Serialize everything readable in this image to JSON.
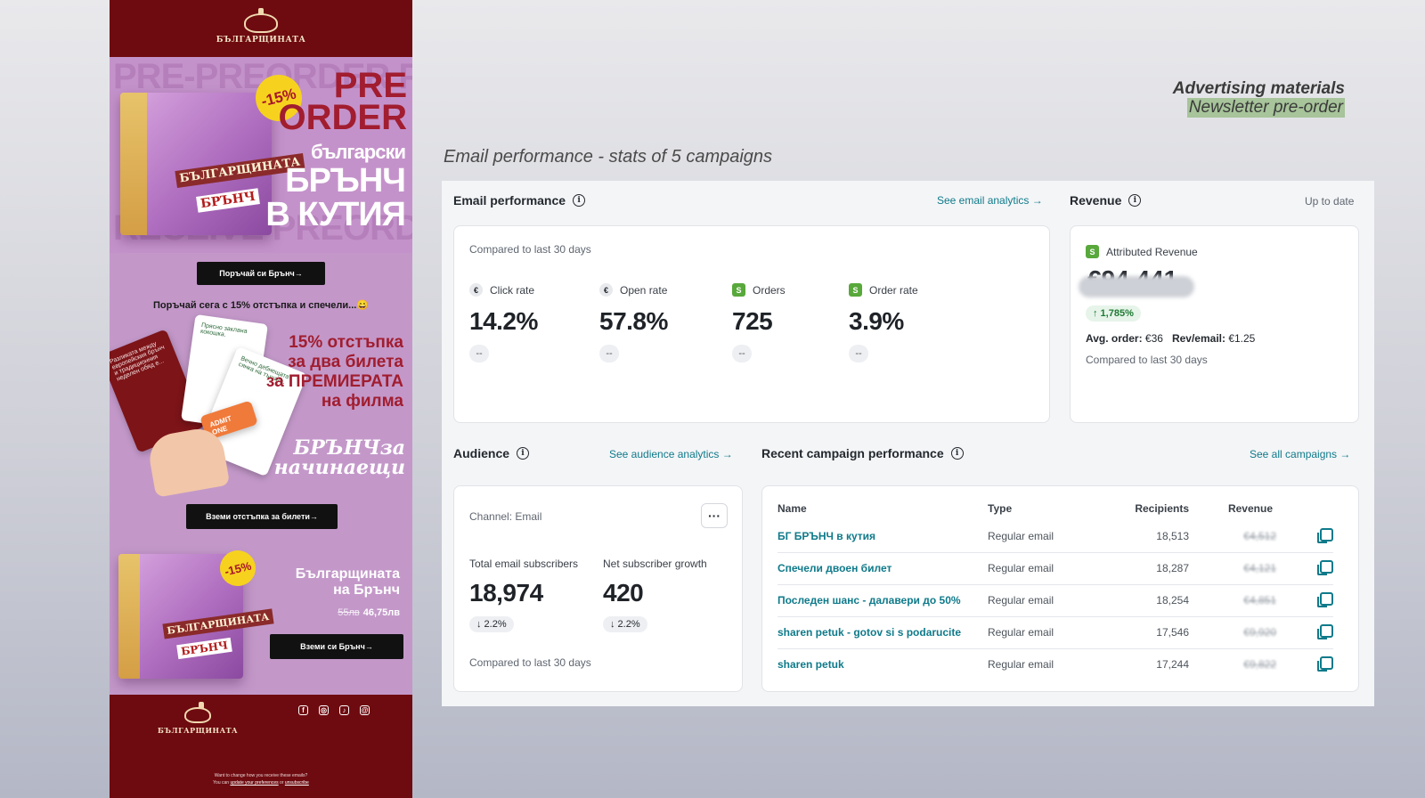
{
  "header": {
    "title": "Advertising materials",
    "subtitle": "Newsletter pre-order",
    "section": "Email performance - stats of 5 campaigns"
  },
  "newsletter": {
    "brand": "БЪЛГАРЩИНАТА",
    "badge": "-15%",
    "preorder_line1": "PRE",
    "preorder_line2": "ORDER",
    "hero_line1": "български",
    "hero_line2": "БРЪНЧ",
    "hero_line3": "В КУТИЯ",
    "box_label": "БЪЛГАРЩИНАТА",
    "box_sub": "БРЪНЧ",
    "cta1": "Поръчай си Брънч→",
    "promo_line": "Поръчай сега с 15% отстъпка и спечели...😄",
    "card1": "Разликата между европейския брънч и традиционния неделен обяд е...",
    "card2": "Прясно заклана кокошка.",
    "card3": "Вечно дебнещата сянка на тъщата.",
    "ticket": "ADMIT ONE",
    "offer_line1": "15% отстъпка",
    "offer_line2": "за два билета",
    "offer_line3": "за ПРЕМИЕРАТА",
    "offer_line4": "на филма",
    "script_line1": "БРЪНЧза",
    "script_line2": "начинаещи",
    "cta2": "Вземи отстъпка за билети→",
    "badge2": "-15%",
    "product_title1": "Българщината",
    "product_title2": "на Брънч",
    "price_old": "55лв",
    "price_new": "46,75лв",
    "cta3": "Вземи си Брънч→",
    "footer_brand": "БЪЛГАРЩИНАТА",
    "footer_note": "Want to change how you receive these emails?",
    "footer_you_can": "You can",
    "footer_update": "update your preferences",
    "footer_or": "or",
    "footer_unsub": "unsubscribe",
    "social_icons": [
      "facebook-icon",
      "instagram-icon",
      "tiktok-icon",
      "threads-icon"
    ]
  },
  "email_perf": {
    "title": "Email performance",
    "link": "See email analytics →",
    "compared": "Compared to last 30 days",
    "metrics": [
      {
        "label": "Click rate",
        "value": "14.2%",
        "delta": "--",
        "icon": "klaviyo-icon"
      },
      {
        "label": "Open rate",
        "value": "57.8%",
        "delta": "--",
        "icon": "klaviyo-icon"
      },
      {
        "label": "Orders",
        "value": "725",
        "delta": "--",
        "icon": "shopify-icon"
      },
      {
        "label": "Order rate",
        "value": "3.9%",
        "delta": "--",
        "icon": "shopify-icon"
      }
    ]
  },
  "revenue": {
    "title": "Revenue",
    "status": "Up to date",
    "label": "Attributed Revenue",
    "value_partial": "€94,441",
    "change": "↑ 1,785%",
    "avg_label": "Avg. order:",
    "avg_value": "€36",
    "rev_label": "Rev/email:",
    "rev_value": "€1.25",
    "compared": "Compared to last 30 days"
  },
  "audience": {
    "title": "Audience",
    "link": "See audience analytics →",
    "channel": "Channel: Email",
    "more": "···",
    "subs_label": "Total email subscribers",
    "subs_value": "18,974",
    "subs_delta": "↓ 2.2%",
    "growth_label": "Net subscriber growth",
    "growth_value": "420",
    "growth_delta": "↓ 2.2%",
    "compared": "Compared to last 30 days"
  },
  "campaigns": {
    "title": "Recent campaign performance",
    "link": "See all campaigns →",
    "columns": {
      "name": "Name",
      "type": "Type",
      "recipients": "Recipients",
      "revenue": "Revenue"
    },
    "rows": [
      {
        "name": "БГ БРЪНЧ в кутия",
        "type": "Regular email",
        "recipients": "18,513",
        "revenue": "€4,512"
      },
      {
        "name": "Спечели двоен билет",
        "type": "Regular email",
        "recipients": "18,287",
        "revenue": "€4,121"
      },
      {
        "name": "Последен шанс - далавери до 50%",
        "type": "Regular email",
        "recipients": "18,254",
        "revenue": "€4,851"
      },
      {
        "name": "sharen petuk - gotov si s podarucite",
        "type": "Regular email",
        "recipients": "17,546",
        "revenue": "€9,920"
      },
      {
        "name": "sharen petuk",
        "type": "Regular email",
        "recipients": "17,244",
        "revenue": "€9,822"
      }
    ]
  },
  "colors": {
    "accent": "#0f7a8a",
    "newsletter_bg": "#c398c9",
    "brand_red": "#6e0b10",
    "success": "#1f7a34"
  }
}
